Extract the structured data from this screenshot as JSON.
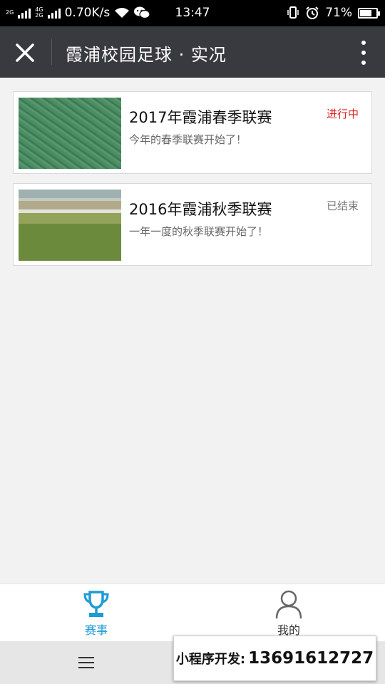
{
  "status_bar": {
    "network_a": "2G",
    "network_b": "4G",
    "network_c": "2G",
    "speed": "0.70K/s",
    "time": "13:47",
    "battery": "71%",
    "battery_level": 0.71
  },
  "nav": {
    "title": "霞浦校园足球 · 实况"
  },
  "matches": [
    {
      "title": "2017年霞浦春季联赛",
      "desc": "今年的春季联赛开始了！",
      "status": "进行中",
      "status_color": "#e02020"
    },
    {
      "title": "2016年霞浦秋季联赛",
      "desc": "一年一度的秋季联赛开始了！",
      "status": "已结束",
      "status_color": "#777777"
    }
  ],
  "tabs": [
    {
      "label": "赛事",
      "icon": "trophy-icon",
      "active": true,
      "color": "#1e9bd7"
    },
    {
      "label": "我的",
      "icon": "user-icon",
      "active": false,
      "color": "#333333"
    }
  ],
  "promo": {
    "label": "小程序开发:",
    "phone": "13691612727"
  },
  "colors": {
    "nav_bg": "#393a3f",
    "page_bg": "#f2f2f2",
    "accent": "#1e9bd7"
  }
}
